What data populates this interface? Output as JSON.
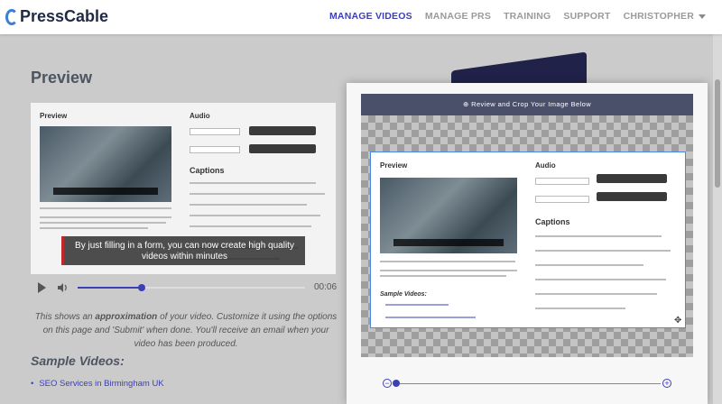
{
  "brand": {
    "name": "PressCable"
  },
  "nav": {
    "items": [
      "MANAGE VIDEOS",
      "MANAGE PRS",
      "TRAINING",
      "SUPPORT"
    ],
    "user": "CHRISTOPHER",
    "active_color": "#3d3fb5"
  },
  "page": {
    "title": "Preview",
    "inner_preview_label": "Preview",
    "audio_label": "Audio",
    "captions_label": "Captions",
    "caption_text": "By just filling in a form, you can now create high quality videos within minutes",
    "player_time": "00:06",
    "player_progress": 0.28,
    "description_intro": "This shows an ",
    "description_bold": "approximation",
    "description_rest": " of your video. Customize it using the options on this page and 'Submit' when done. You'll receive an email when your video has been produced.",
    "sample_videos_label": "Sample Videos:",
    "sample_videos": [
      "SEO Services in Birmingham UK"
    ]
  },
  "modal": {
    "header": "⊕ Review and Crop Your Image Below",
    "zoom_minus": "−",
    "zoom_plus": "+",
    "zoom_level": 0.0,
    "inner_preview_label": "Preview",
    "inner_audio_label": "Audio",
    "inner_captions_label": "Captions",
    "inner_sample_label": "Sample Videos:"
  },
  "icons": {
    "play": "play-icon",
    "volume": "volume-icon",
    "move": "move-icon"
  }
}
